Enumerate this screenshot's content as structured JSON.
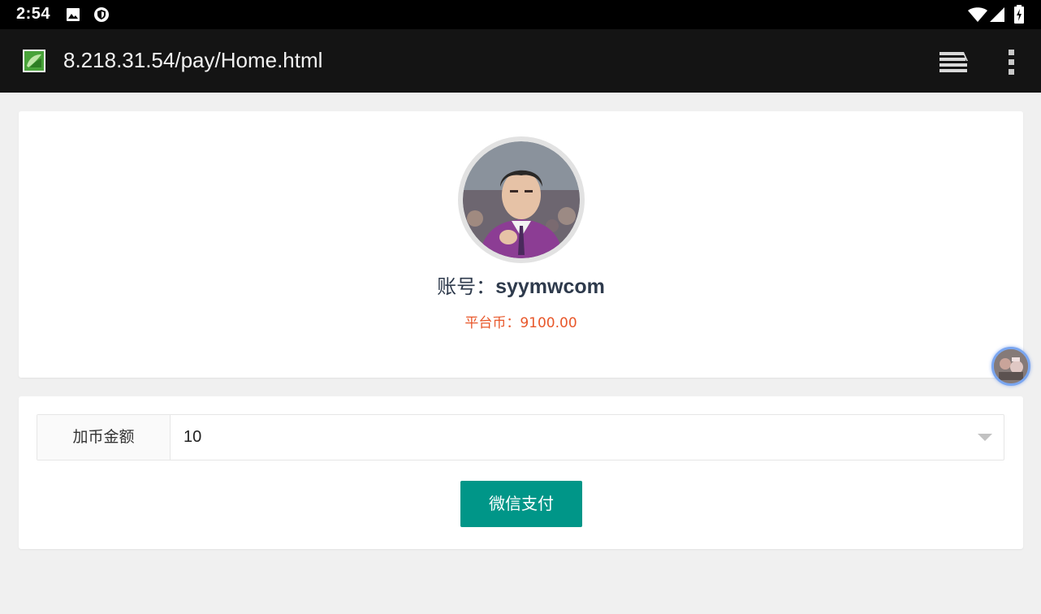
{
  "status_bar": {
    "time": "2:54",
    "icons": [
      "image-notification-icon",
      "shield-icon",
      "wifi-icon",
      "cell-signal-icon",
      "battery-charging-icon"
    ]
  },
  "browser": {
    "url": "8.218.31.54/pay/Home.html",
    "favicon": "site-favicon-icon",
    "tabs_icon": "tabs-stack-icon",
    "menu_icon": "more-vert-icon"
  },
  "profile": {
    "account_label": "账号：",
    "account_value": "syymwcom",
    "coins_text": "平台币：9100.00"
  },
  "payment": {
    "amount_label": "加币金额",
    "amount_value": "10",
    "pay_button": "微信支付"
  },
  "colors": {
    "accent": "#009688",
    "coins": "#e8572a",
    "toolbar": "#141414"
  }
}
